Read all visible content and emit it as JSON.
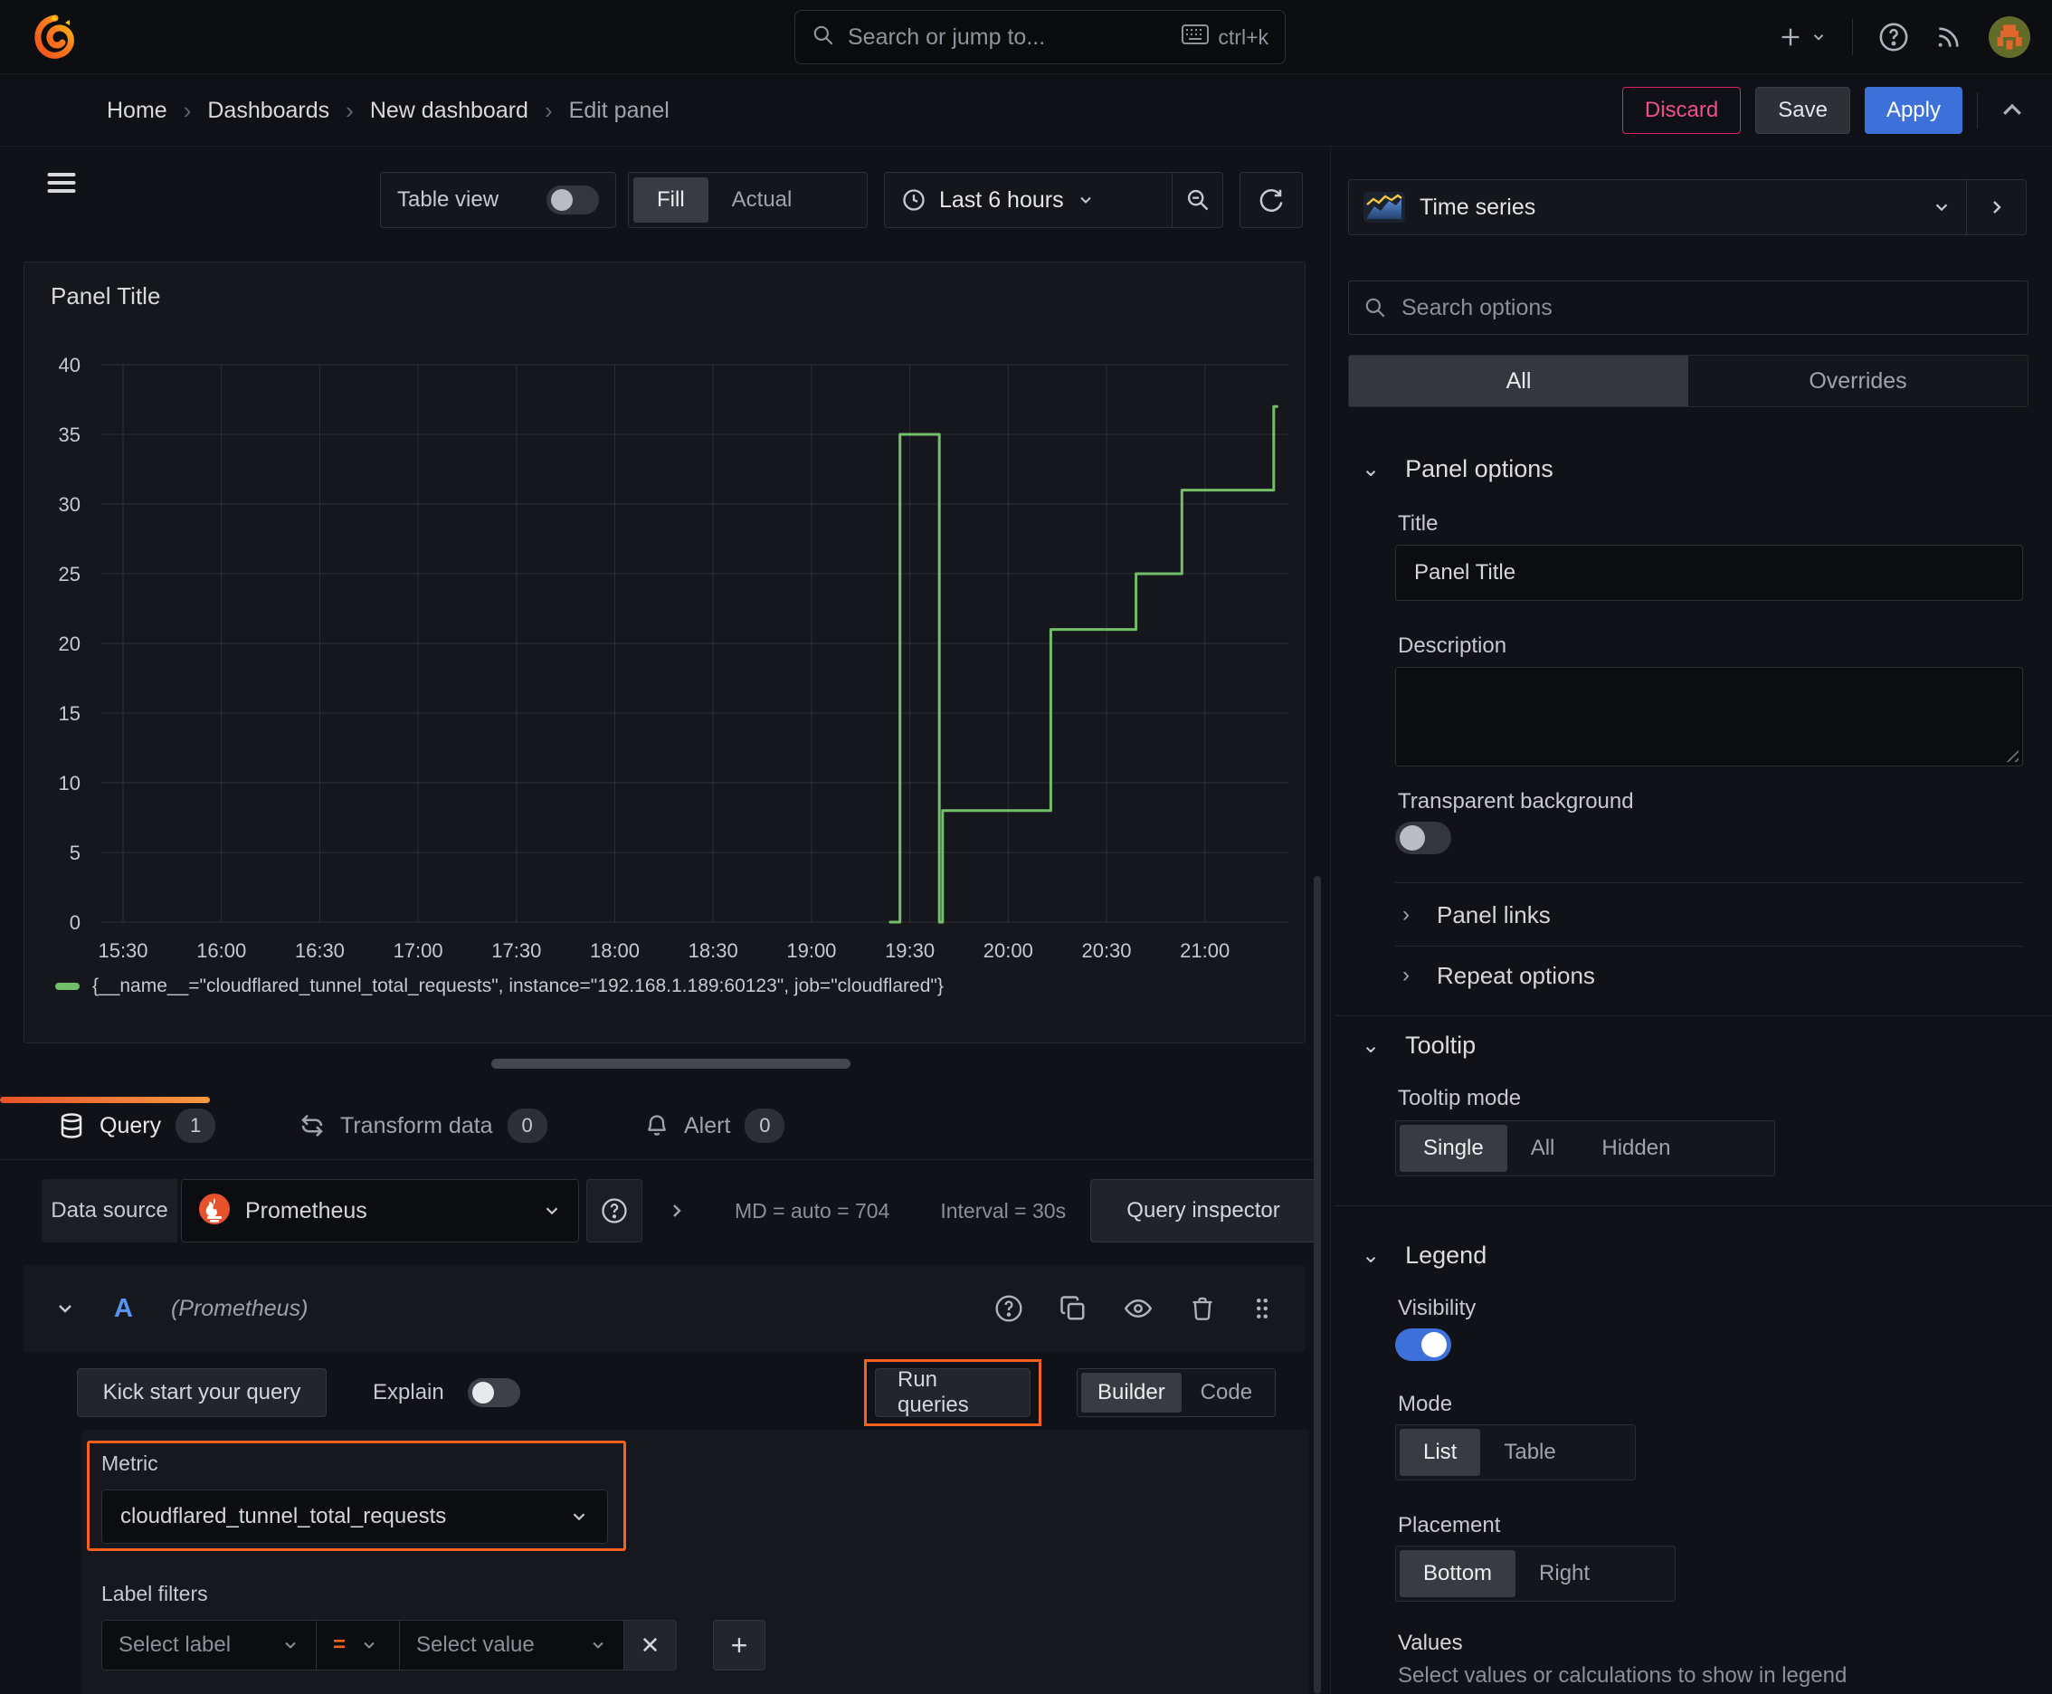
{
  "colors": {
    "accent_orange": "#f5621d",
    "brand_blue": "#3d71d9",
    "series_green": "#73bf69",
    "discard_pink": "#e0226c"
  },
  "icons": {
    "breadcrumb_separator": "›",
    "chevron_down": "⌄",
    "chevron_right": "›",
    "chevron_up": "⌃",
    "plus": "+",
    "close": "✕",
    "question": "?",
    "equals": "="
  },
  "topnav": {
    "search_placeholder": "Search or jump to...",
    "search_shortcut": "ctrl+k"
  },
  "breadcrumb": {
    "items": [
      "Home",
      "Dashboards",
      "New dashboard",
      "Edit panel"
    ]
  },
  "header_actions": {
    "discard": "Discard",
    "save": "Save",
    "apply": "Apply"
  },
  "toolbar": {
    "table_view_label": "Table view",
    "fill_label": "Fill",
    "actual_label": "Actual",
    "time_range_label": "Last 6 hours"
  },
  "panel": {
    "title": "Panel Title"
  },
  "chart_data": {
    "type": "line",
    "title": "Panel Title",
    "line_color": "#73bf69",
    "grid": true,
    "legend_position": "bottom",
    "x_ticks": [
      "15:30",
      "16:00",
      "16:30",
      "17:00",
      "17:30",
      "18:00",
      "18:30",
      "19:00",
      "19:30",
      "20:00",
      "20:30",
      "21:00"
    ],
    "y_ticks": [
      0,
      5,
      10,
      15,
      20,
      25,
      30,
      35,
      40
    ],
    "ylim": [
      0,
      40
    ],
    "legend": [
      {
        "label": "{__name__=\"cloudflared_tunnel_total_requests\", instance=\"192.168.1.189:60123\", job=\"cloudflared\"}",
        "color": "#73bf69"
      }
    ],
    "series": [
      {
        "name": "cloudflared_tunnel_total_requests",
        "mode": "stepped",
        "points_time_value": [
          [
            "19:24",
            0
          ],
          [
            "19:27",
            0
          ],
          [
            "19:27",
            35
          ],
          [
            "19:39",
            35
          ],
          [
            "19:39",
            0
          ],
          [
            "19:40",
            0
          ],
          [
            "19:40",
            8
          ],
          [
            "20:13",
            8
          ],
          [
            "20:13",
            21
          ],
          [
            "20:39",
            21
          ],
          [
            "20:39",
            25
          ],
          [
            "20:53",
            25
          ],
          [
            "20:53",
            31
          ],
          [
            "21:21",
            31
          ],
          [
            "21:21",
            37
          ],
          [
            "21:22",
            37
          ]
        ]
      }
    ]
  },
  "query_section": {
    "tabs": [
      {
        "label": "Query",
        "badge": "1"
      },
      {
        "label": "Transform data",
        "badge": "0"
      },
      {
        "label": "Alert",
        "badge": "0"
      }
    ],
    "datasource": {
      "label": "Data source",
      "name": "Prometheus",
      "stats_md": "MD = auto = 704",
      "stats_interval": "Interval = 30s",
      "inspector_label": "Query inspector"
    },
    "query_row": {
      "ref_id": "A",
      "datasource_hint": "(Prometheus)"
    },
    "actions": {
      "kickstart": "Kick start your query",
      "explain": "Explain",
      "run": "Run queries",
      "builder": "Builder",
      "code": "Code"
    },
    "builder": {
      "metric_label": "Metric",
      "metric_value": "cloudflared_tunnel_total_requests",
      "label_filters_label": "Label filters",
      "select_label_placeholder": "Select label",
      "operator": "=",
      "select_value_placeholder": "Select value"
    }
  },
  "sidebar": {
    "viz_name": "Time series",
    "search_placeholder": "Search options",
    "tabs": {
      "all": "All",
      "overrides": "Overrides"
    },
    "panel_options": {
      "title": "Panel options",
      "title_label": "Title",
      "title_value": "Panel Title",
      "description_label": "Description",
      "transparent_label": "Transparent background"
    },
    "collapsed": {
      "panel_links": "Panel links",
      "repeat_options": "Repeat options"
    },
    "tooltip": {
      "title": "Tooltip",
      "mode_label": "Tooltip mode",
      "options": [
        "Single",
        "All",
        "Hidden"
      ],
      "selected": "Single"
    },
    "legend": {
      "title": "Legend",
      "visibility_label": "Visibility",
      "mode_label": "Mode",
      "mode_options": [
        "List",
        "Table"
      ],
      "mode_selected": "List",
      "placement_label": "Placement",
      "placement_options": [
        "Bottom",
        "Right"
      ],
      "placement_selected": "Bottom",
      "values_label": "Values",
      "values_desc": "Select values or calculations to show in legend"
    }
  }
}
